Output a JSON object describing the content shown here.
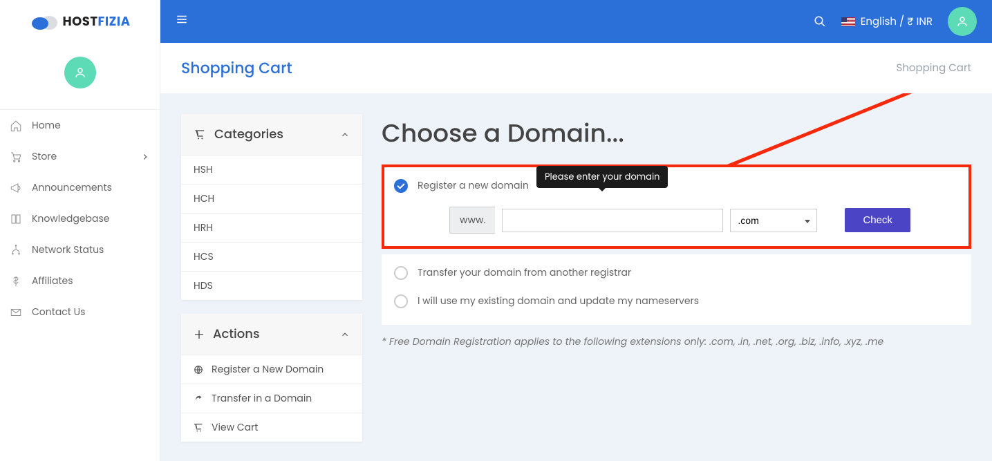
{
  "brand": {
    "part1": "HOST",
    "part2": "FIZIA"
  },
  "topbar": {
    "lang": "English / ₹ INR"
  },
  "nav": {
    "home": "Home",
    "store": "Store",
    "announcements": "Announcements",
    "knowledgebase": "Knowledgebase",
    "network": "Network Status",
    "affiliates": "Affiliates",
    "contact": "Contact Us"
  },
  "header": {
    "title": "Shopping Cart",
    "breadcrumb": "Shopping Cart"
  },
  "categories": {
    "title": "Categories",
    "items": [
      "HSH",
      "HCH",
      "HRH",
      "HCS",
      "HDS"
    ]
  },
  "actions": {
    "title": "Actions",
    "register": "Register a New Domain",
    "transfer": "Transfer in a Domain",
    "viewcart": "View Cart"
  },
  "domain": {
    "heading": "Choose a Domain...",
    "opt_register": "Register a new domain",
    "opt_transfer": "Transfer your domain from another registrar",
    "opt_existing": "I will use my existing domain and update my nameservers",
    "tooltip": "Please enter your domain",
    "prefix": "www.",
    "tld": ".com",
    "check": "Check",
    "footnote": "* Free Domain Registration applies to the following extensions only: .com, .in, .net, .org, .biz, .info, .xyz, .me"
  }
}
